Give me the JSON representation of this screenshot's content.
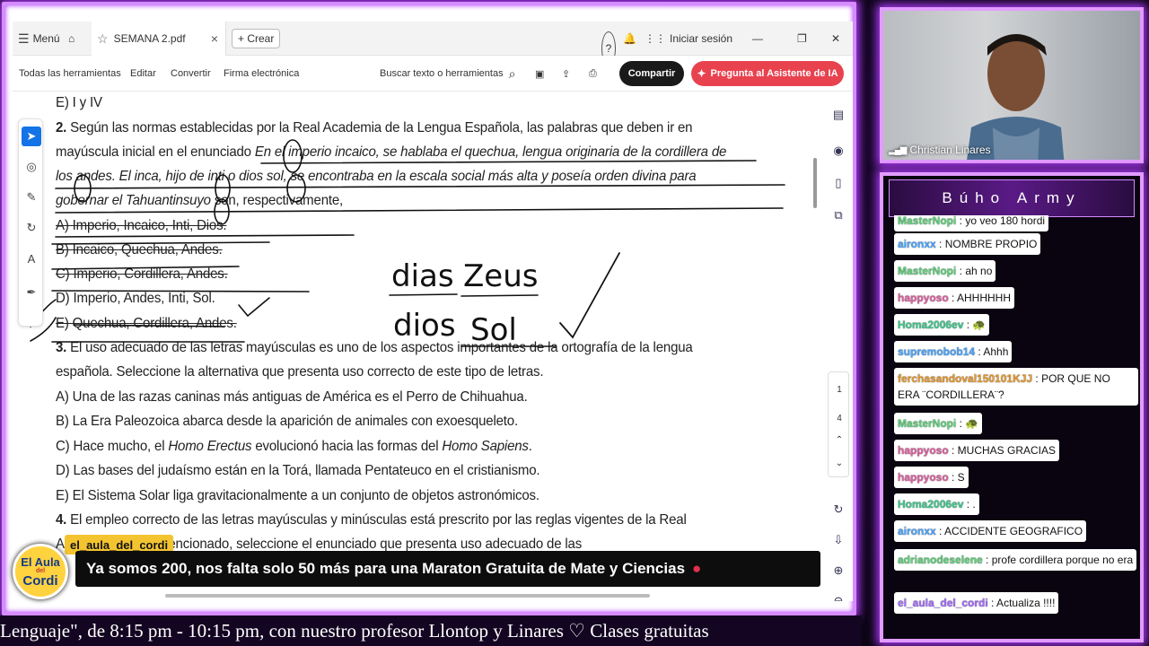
{
  "tabbar": {
    "menu_label": "Menú",
    "doc_tab": "SEMANA 2.pdf",
    "new_tab": "+ Crear",
    "signin": "Iniciar sesión"
  },
  "toolbar": {
    "all_tools": "Todas las herramientas",
    "edit": "Editar",
    "convert": "Convertir",
    "sign": "Firma electrónica",
    "search": "Buscar texto o herramientas",
    "share": "Compartir",
    "ai": "Pregunta al Asistente de IA"
  },
  "page_nav": {
    "current": "1",
    "total": "4"
  },
  "document": {
    "l0": "E) I y IV",
    "q2_num": "2.",
    "l1": "Según las normas establecidas por la Real Academia de la Lengua Española, las palabras que deben ir en",
    "l2a": "mayúscula inicial en el enunciado ",
    "l2b": "En el imperio incaico, se hablaba el quechua, lengua originaria de la cordillera de",
    "l3": "los andes. El inca, hijo de inti o dios sol, se encontraba en la escala social más alta y poseía orden divina para",
    "l4a": "gobernar el Tahuantinsuyo",
    "l4b": " son, respectivamente,",
    "optA": "A) Imperio, Incaico, Inti, Dios.",
    "optB": "B) Incaico, Quechua, Andes.",
    "optC": "C) Imperio, Cordillera, Andes.",
    "optD": "D) Imperio, Andes, Inti, Sol.",
    "optE": "E) Quechua, Cordillera, Andes.",
    "q3_num": "3.",
    "q3a": "El uso adecuado de las letras mayúsculas es uno de los aspectos importantes de la ortografía de la lengua",
    "q3b": "española. Seleccione la alternativa que presenta uso correcto de este tipo de letras.",
    "q3A": "A) Una de las razas caninas más antiguas de América es el Perro de Chihuahua.",
    "q3B": "B) La Era Paleozoica abarca desde la aparición de animales con exoesqueleto.",
    "q3C_a": "C) Hace mucho, el ",
    "q3C_b": "Homo Erectus",
    "q3C_c": " evolucionó hacia las formas del ",
    "q3C_d": "Homo Sapiens",
    "q3C_e": ".",
    "q3D": "D) Las bases del judaísmo están en la Torá, llamada Pentateuco en el cristianismo.",
    "q3E": "E) El Sistema Solar liga gravitacionalmente a un conjunto de objetos astronómicos.",
    "q4_num": "4.",
    "q4a": "El empleo correcto de las letras mayúsculas y minúsculas está prescrito por las reglas vigentes de la Real",
    "q4b": "A                    acuerdo con lo mencionado, seleccione el enunciado que presenta uso adecuado de las"
  },
  "handwriting": {
    "w1": "dias",
    "w2": "dios",
    "w3": "Zeus",
    "w4": "Sol"
  },
  "overlay": {
    "tag": "el_aula_del_cordi",
    "logo_l1": "El Aula",
    "logo_l2": "Cordi",
    "logo_l3": "del",
    "announce": "Ya somos 200, nos falta solo 50 más para una Maraton Gratuita de Mate y Ciencias",
    "ticker": "Lenguaje\", de 8:15 pm - 10:15 pm, con nuestro profesor Llontop y Linares ♡     Clases gratuitas"
  },
  "webcam": {
    "name": "Christian Linares"
  },
  "chat": {
    "title": "Búho Army",
    "messages": [
      {
        "user": "MasterNopi",
        "text": ": yo veo 180 hordi",
        "color": "#5ed07a"
      },
      {
        "user": "aironxx",
        "text": ": NOMBRE PROPIO",
        "color": "#4aa6ff"
      },
      {
        "user": "MasterNopi",
        "text": ": ah no",
        "color": "#5ed07a"
      },
      {
        "user": "happyoso",
        "text": ": AHHHHHH",
        "color": "#e060a0"
      },
      {
        "user": "Homa2006ev",
        "text": ": 🐢",
        "color": "#3fc98d"
      },
      {
        "user": "supremobob14",
        "text": ": Ahhh",
        "color": "#4aa6ff"
      },
      {
        "user": "ferchasandoval150101KJJ",
        "text": ": POR QUE NO ERA ¨CORDILLERA¨?",
        "color": "#e69a2e"
      },
      {
        "user": "MasterNopi",
        "text": ": 🐢",
        "color": "#5ed07a"
      },
      {
        "user": "happyoso",
        "text": ": MUCHAS GRACIAS",
        "color": "#e060a0"
      },
      {
        "user": "happyoso",
        "text": ": S",
        "color": "#e060a0"
      },
      {
        "user": "Homa2006ev",
        "text": ": .",
        "color": "#3fc98d"
      },
      {
        "user": "aironxx",
        "text": ": ACCIDENTE GEOGRAFICO",
        "color": "#4aa6ff"
      },
      {
        "user": "adrianodeselene",
        "text": ": profe cordillera porque no era",
        "color": "#5ed07a"
      },
      {
        "user": "el_aula_del_cordi",
        "text": ": Actualiza !!!!",
        "color": "#a56bff"
      }
    ]
  }
}
